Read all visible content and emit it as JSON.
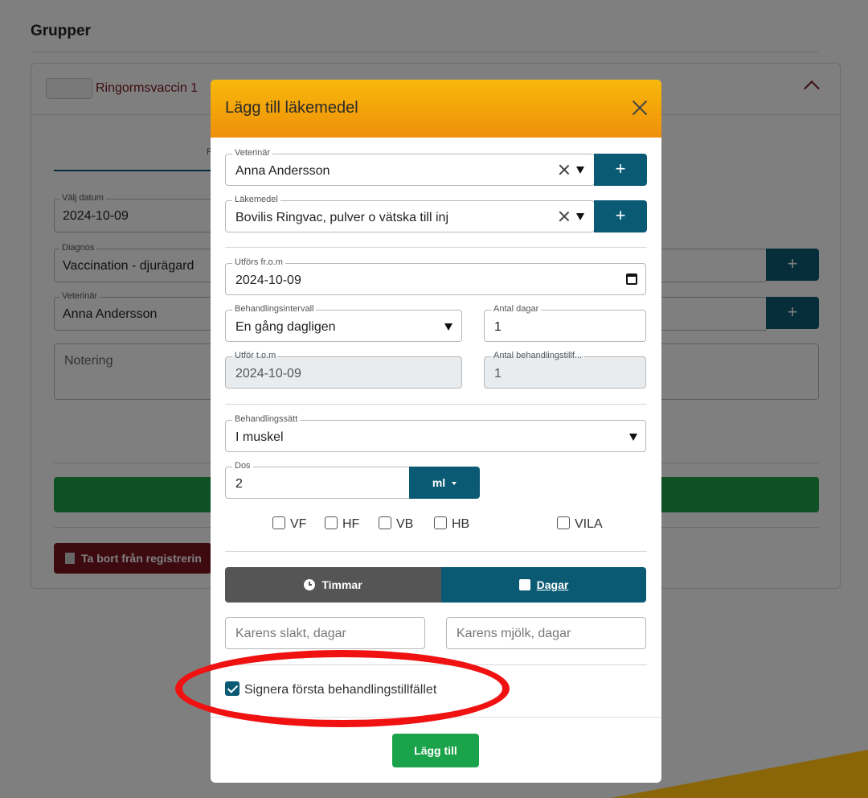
{
  "background": {
    "title": "Grupper",
    "group_name": "Ringormsvaccin 1",
    "date_label": "Välj datum",
    "date_value": "2024-10-09",
    "diagnosis_label": "Diagnos",
    "diagnosis_value": "Vaccination - djurägard",
    "vet_label": "Veterinär",
    "vet_value": "Anna Andersson",
    "note_placeholder": "Notering",
    "delete_label": "Ta bort från registrerin",
    "plus_label": "+"
  },
  "modal": {
    "title": "Lägg till läkemedel",
    "veterinarian": {
      "label": "Veterinär",
      "value": "Anna Andersson"
    },
    "medicine": {
      "label": "Läkemedel",
      "value": "Bovilis Ringvac, pulver o vätska till inj"
    },
    "performed_from": {
      "label": "Utförs fr.o.m",
      "value": "2024-10-09"
    },
    "interval": {
      "label": "Behandlingsintervall",
      "value": "En gång dagligen"
    },
    "num_days": {
      "label": "Antal dagar",
      "value": "1"
    },
    "performed_until": {
      "label": "Utför t.o.m",
      "value": "2024-10-09"
    },
    "num_treatments": {
      "label": "Antal behandlingstillf...",
      "value": "1"
    },
    "method": {
      "label": "Behandlingssätt",
      "value": "I muskel"
    },
    "dose": {
      "label": "Dos",
      "value": "2",
      "unit": "ml"
    },
    "checkboxes": [
      "VF",
      "HF",
      "VB",
      "HB",
      "VILA"
    ],
    "toggle": {
      "hours": "Timmar",
      "days": "Dagar"
    },
    "withdrawal_slaughter_placeholder": "Karens slakt, dagar",
    "withdrawal_milk_placeholder": "Karens mjölk, dagar",
    "sign_first": "Signera första behandlingstillfället",
    "submit": "Lägg till",
    "plus_label": "+"
  },
  "colors": {
    "primary": "#0a5a74",
    "success": "#1aa34a",
    "header_gradient_top": "#f8b90b",
    "header_gradient_bottom": "#ef8f0a",
    "danger": "#7a1420",
    "annotation": "#f01111"
  }
}
